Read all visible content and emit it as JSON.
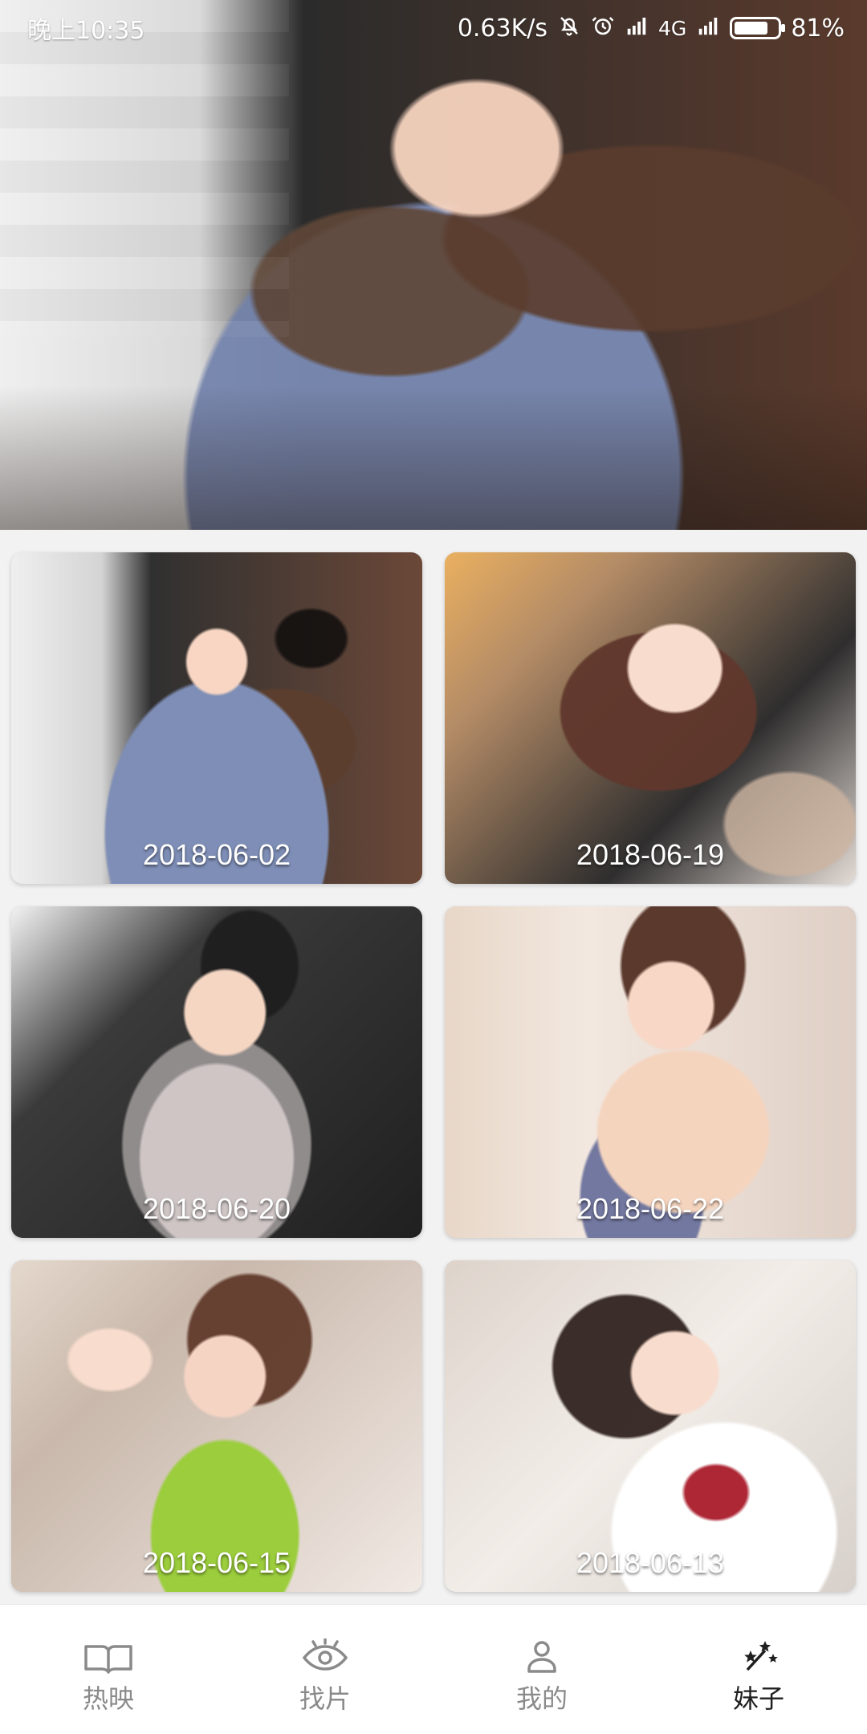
{
  "status_bar": {
    "time": "晚上10:35",
    "network_speed": "0.63K/s",
    "network_type": "4G",
    "battery_percent": "81%",
    "battery_level": 0.81,
    "icons": [
      "muted-bell-icon",
      "alarm-icon",
      "signal-icon",
      "signal-icon",
      "battery-icon"
    ]
  },
  "feed": {
    "items": [
      {
        "date": "2018-06-02"
      },
      {
        "date": "2018-06-19"
      },
      {
        "date": "2018-06-20"
      },
      {
        "date": "2018-06-22"
      },
      {
        "date": "2018-06-15"
      },
      {
        "date": "2018-06-13"
      }
    ]
  },
  "bottom_nav": {
    "items": [
      {
        "label": "热映",
        "icon": "book-icon"
      },
      {
        "label": "找片",
        "icon": "eye-icon"
      },
      {
        "label": "我的",
        "icon": "user-icon"
      },
      {
        "label": "妹子",
        "icon": "magic-wand-stars-icon"
      }
    ],
    "active_index": 3
  },
  "colors": {
    "status_text": "#ffffff",
    "inactive_nav": "#8a8a8a",
    "active_nav": "#1f1f1f",
    "background": "#f2f2f2",
    "nav_background": "#ffffff"
  }
}
